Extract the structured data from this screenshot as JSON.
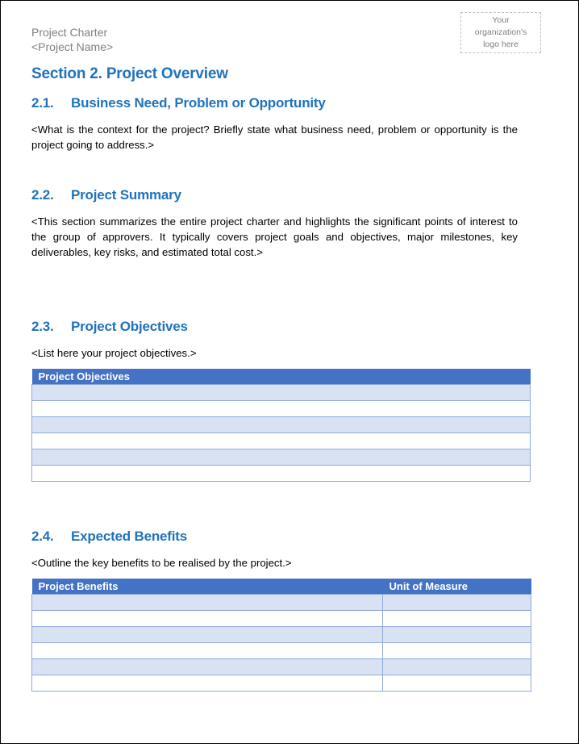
{
  "header": {
    "doc_title": "Project Charter",
    "project_name": "<Project Name>",
    "logo_placeholder": "Your\norganization's\nlogo here"
  },
  "section": {
    "title": "Section 2. Project Overview"
  },
  "subsections": [
    {
      "number": "2.1.",
      "title": "Business Need, Problem or Opportunity",
      "body": "<What is the context for the project? Briefly state what business need, problem or opportunity is the project going to address.>"
    },
    {
      "number": "2.2.",
      "title": "Project Summary",
      "body": "<This section summarizes the entire project charter and highlights the significant points of interest to the group of approvers. It typically covers project goals and objectives, major milestones, key deliverables, key risks, and estimated total cost.>"
    },
    {
      "number": "2.3.",
      "title": "Project Objectives",
      "body": "<List here your project objectives.>"
    },
    {
      "number": "2.4.",
      "title": "Expected Benefits",
      "body": "<Outline the key benefits to be realised by the project.>"
    }
  ],
  "objectives_table": {
    "headers": [
      "Project Objectives"
    ],
    "rows": [
      [
        ""
      ],
      [
        ""
      ],
      [
        ""
      ],
      [
        ""
      ],
      [
        ""
      ],
      [
        ""
      ]
    ]
  },
  "benefits_table": {
    "headers": [
      "Project Benefits",
      "Unit of Measure"
    ],
    "rows": [
      [
        "",
        ""
      ],
      [
        "",
        ""
      ],
      [
        "",
        ""
      ],
      [
        "",
        ""
      ],
      [
        "",
        ""
      ],
      [
        "",
        ""
      ]
    ]
  },
  "colors": {
    "heading": "#1f73bc",
    "table_header": "#4472c4",
    "table_band": "#d9e2f3",
    "table_border": "#8eaadb"
  }
}
